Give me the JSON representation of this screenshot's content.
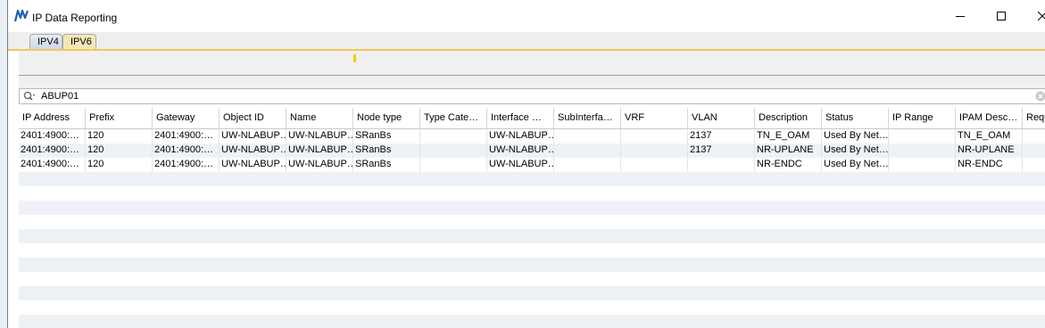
{
  "window": {
    "title": "IP Data Reporting"
  },
  "tabs": [
    {
      "label": "IPV4",
      "active": false
    },
    {
      "label": "IPV6",
      "active": true
    }
  ],
  "search": {
    "value": "ABUP01"
  },
  "table": {
    "columns": [
      "IP Address",
      "Prefix",
      "Gateway",
      "Object ID",
      "Name",
      "Node type",
      "Type Cate…",
      "Interface …",
      "SubInterfa…",
      "VRF",
      "VLAN",
      "Description",
      "Status",
      "IP Range",
      "IPAM Desc…",
      "Requ"
    ],
    "rows": [
      [
        "2401:4900:…",
        "120",
        "2401:4900:…",
        "UW-NLABUP…",
        "UW-NLABUP…",
        "SRanBs",
        "",
        "UW-NLABUP…",
        "",
        "",
        "2137",
        "TN_E_OAM",
        "Used By Net…",
        "",
        "TN_E_OAM",
        ""
      ],
      [
        "2401:4900:…",
        "120",
        "2401:4900:…",
        "UW-NLABUP…",
        "UW-NLABUP…",
        "SRanBs",
        "",
        "UW-NLABUP…",
        "",
        "",
        "2137",
        "NR-UPLANE",
        "Used By Net…",
        "",
        "NR-UPLANE",
        ""
      ],
      [
        "2401:4900:…",
        "120",
        "2401:4900:…",
        "UW-NLABUP…",
        "UW-NLABUP…",
        "SRanBs",
        "",
        "UW-NLABUP…",
        "",
        "",
        "",
        "NR-ENDC",
        "Used By Net…",
        "",
        "NR-ENDC",
        ""
      ]
    ]
  },
  "colors": {
    "active_tab": "#f6e7b7",
    "tab_underline": "#f0c75e",
    "row_stripe": "#eef2f7"
  },
  "icons": {
    "app": "app-logo-icon",
    "minimize": "minimize-icon",
    "maximize": "maximize-icon",
    "close": "close-icon",
    "search": "search-icon",
    "clear": "clear-icon"
  }
}
